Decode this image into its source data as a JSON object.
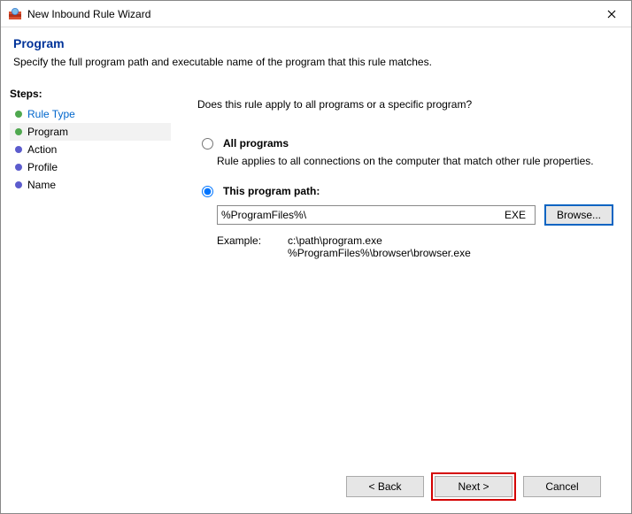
{
  "window": {
    "title": "New Inbound Rule Wizard"
  },
  "header": {
    "title": "Program",
    "subtitle": "Specify the full program path and executable name of the program that this rule matches."
  },
  "sidebar": {
    "title": "Steps:",
    "items": [
      {
        "label": "Rule Type"
      },
      {
        "label": "Program"
      },
      {
        "label": "Action"
      },
      {
        "label": "Profile"
      },
      {
        "label": "Name"
      }
    ]
  },
  "main": {
    "question": "Does this rule apply to all programs or a specific program?",
    "option_all": {
      "label": "All programs",
      "desc": "Rule applies to all connections on the computer that match other rule properties."
    },
    "option_path": {
      "label": "This program path:",
      "value": "%ProgramFiles%\\",
      "ext": "EXE",
      "browse": "Browse..."
    },
    "example": {
      "label": "Example:",
      "line1": "c:\\path\\program.exe",
      "line2": "%ProgramFiles%\\browser\\browser.exe"
    }
  },
  "footer": {
    "back": "< Back",
    "next": "Next >",
    "cancel": "Cancel"
  }
}
